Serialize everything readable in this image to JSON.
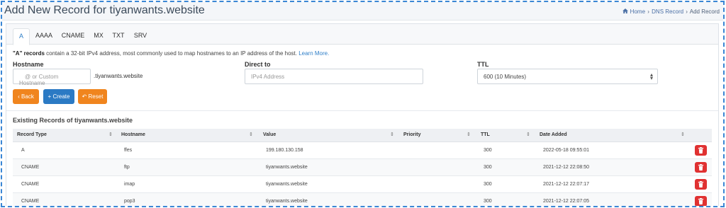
{
  "page": {
    "title": "Add New Record for tiyanwants.website",
    "breadcrumb": {
      "home": "Home",
      "dns": "DNS Record",
      "current": "Add Record"
    }
  },
  "tabs": [
    "A",
    "AAAA",
    "CNAME",
    "MX",
    "TXT",
    "SRV"
  ],
  "form": {
    "desc_bold": "\"A\" records",
    "desc_text": " contain a 32-bit IPv4 address, most commonly used to map hostnames to an IP address of the host. ",
    "desc_link": "Learn More.",
    "hostname_label": "Hostname",
    "hostname_placeholder": "@ or Custom Hostname",
    "hostname_suffix": ".tiyanwants.website",
    "direct_label": "Direct to",
    "direct_placeholder": "IPv4 Address",
    "ttl_label": "TTL",
    "ttl_value": "600 (10 Minutes)",
    "back_label": "Back",
    "create_label": "Create",
    "reset_label": "Reset"
  },
  "records": {
    "title": "Existing Records of tiyanwants.website",
    "columns": [
      "Record Type",
      "Hostname",
      "Value",
      "Priority",
      "TTL",
      "Date Added"
    ],
    "rows": [
      {
        "type": "A",
        "hostname": "ffes",
        "value": "199.180.130.158",
        "priority": "",
        "ttl": "300",
        "date": "2022-05-18 09:55:01"
      },
      {
        "type": "CNAME",
        "hostname": "ftp",
        "value": "tiyanwants.website",
        "priority": "",
        "ttl": "300",
        "date": "2021-12-12 22:08:50"
      },
      {
        "type": "CNAME",
        "hostname": "imap",
        "value": "tiyanwants.website",
        "priority": "",
        "ttl": "300",
        "date": "2021-12-12 22:07:17"
      },
      {
        "type": "CNAME",
        "hostname": "pop3",
        "value": "tiyanwants.website",
        "priority": "",
        "ttl": "300",
        "date": "2021-12-12 22:07:05"
      }
    ]
  },
  "colors": {
    "accent": "#2f7fc8",
    "orange": "#f0851e",
    "blue": "#2b7ac4",
    "danger": "#e03131"
  },
  "icons": [
    "home-icon",
    "chevron-left-icon",
    "plus-icon",
    "undo-icon",
    "sort-icon",
    "trash-icon",
    "select-arrows-icon"
  ]
}
